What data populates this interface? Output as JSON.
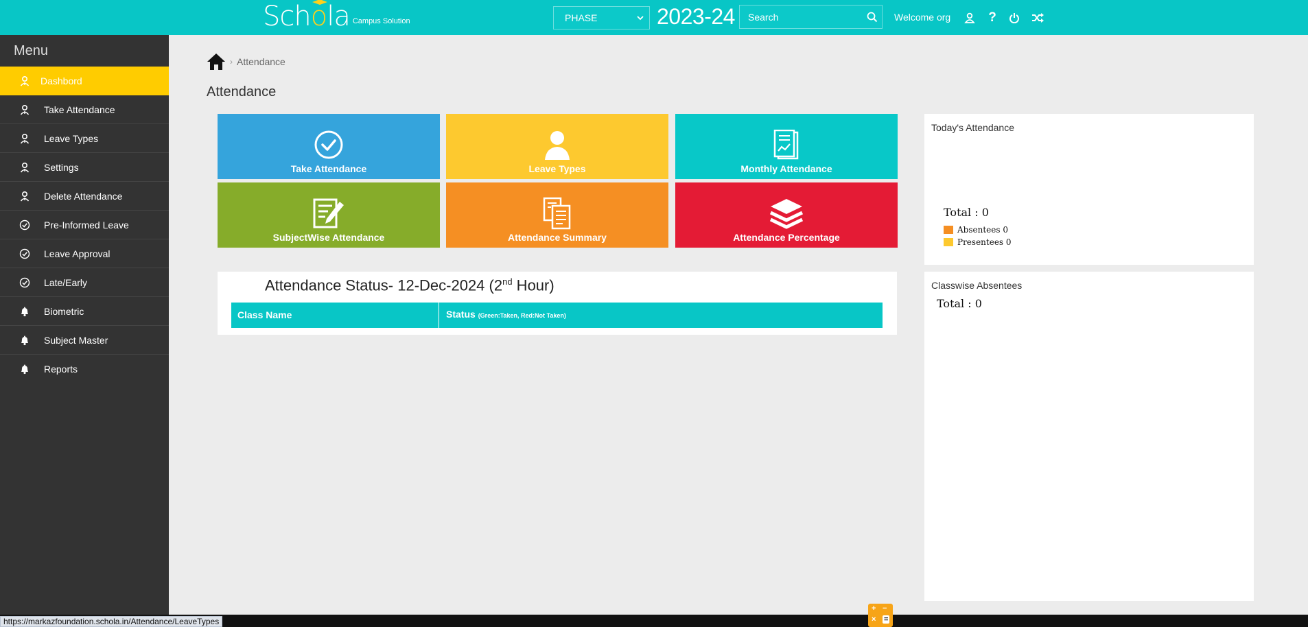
{
  "header": {
    "logo_text_pre": "Sch",
    "logo_text_o": "o",
    "logo_text_post": "la",
    "logo_tagline": "Campus Solution",
    "phase_value": "PHASE",
    "year": "2023-24",
    "search_placeholder": "Search",
    "welcome": "Welcome org",
    "icons": [
      "user-icon",
      "help-icon",
      "power-icon",
      "shuffle-icon"
    ]
  },
  "sidebar": {
    "title": "Menu",
    "items": [
      {
        "label": "Dashbord",
        "icon": "user-icon",
        "active": true
      },
      {
        "label": "Take Attendance",
        "icon": "user-icon"
      },
      {
        "label": "Leave Types",
        "icon": "user-icon"
      },
      {
        "label": "Settings",
        "icon": "user-icon"
      },
      {
        "label": "Delete Attendance",
        "icon": "user-icon"
      },
      {
        "label": "Pre-Informed Leave",
        "icon": "check-circle-icon"
      },
      {
        "label": "Leave Approval",
        "icon": "check-circle-icon"
      },
      {
        "label": "Late/Early",
        "icon": "check-circle-icon"
      },
      {
        "label": "Biometric",
        "icon": "bell-icon"
      },
      {
        "label": "Subject Master",
        "icon": "bell-icon"
      },
      {
        "label": "Reports",
        "icon": "bell-icon"
      }
    ]
  },
  "breadcrumb": {
    "current": "Attendance"
  },
  "page_title": "Attendance",
  "tiles": [
    {
      "label": "Take Attendance",
      "color": "#35a4dc",
      "icon": "check-circle-icon"
    },
    {
      "label": "Leave Types",
      "color": "#fdc92f",
      "icon": "person-icon"
    },
    {
      "label": "Monthly Attendance",
      "color": "#08c8c8",
      "icon": "report-chart-icon"
    },
    {
      "label": "SubjectWise Attendance",
      "color": "#86ac2a",
      "icon": "edit-document-icon"
    },
    {
      "label": "Attendance Summary",
      "color": "#f58f23",
      "icon": "documents-icon"
    },
    {
      "label": "Attendance Percentage",
      "color": "#e41b35",
      "icon": "layers-icon"
    }
  ],
  "status": {
    "title_prefix": "Attendance Status- 12-Dec-2024 (2",
    "title_sup": "nd",
    "title_suffix": " Hour)",
    "col_class": "Class Name",
    "col_status": "Status",
    "col_status_note": "(Green:Taken, Red:Not Taken)"
  },
  "today": {
    "title": "Today's Attendance",
    "total_label": "Total",
    "total_value": "0",
    "absentees_label": "Absentees",
    "absentees_value": "0",
    "presentees_label": "Presentees",
    "presentees_value": "0",
    "absentees_color": "#f58f23",
    "presentees_color": "#fdc92f"
  },
  "classwise": {
    "title": "Classwise Absentees",
    "total_label": "Total",
    "total_value": "0"
  },
  "status_bar": {
    "url": "https://markazfoundation.schola.in/Attendance/LeaveTypes"
  },
  "calculator": {
    "plus": "+",
    "minus": "−",
    "times": "×",
    "equals": "="
  }
}
